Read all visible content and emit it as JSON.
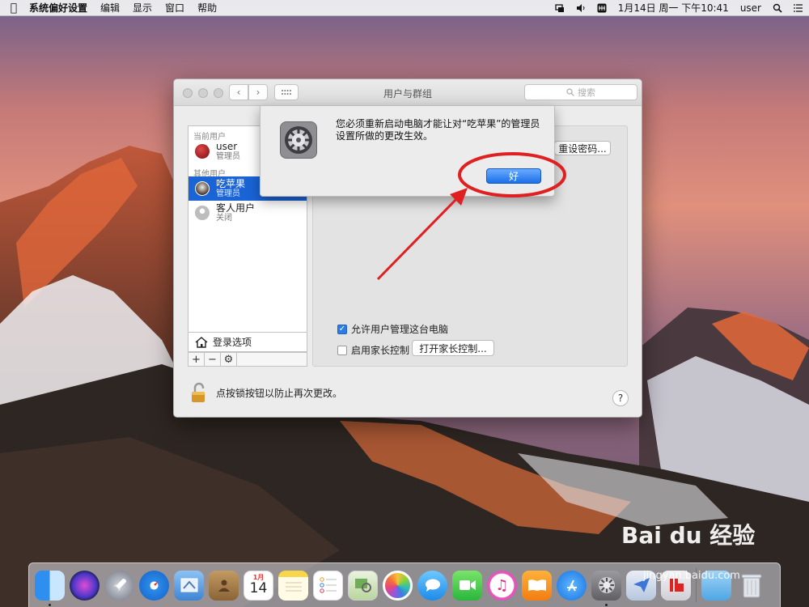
{
  "menubar": {
    "apple_icon": "apple-icon",
    "app_name": "系统偏好设置",
    "menus": [
      "编辑",
      "显示",
      "窗口",
      "帮助"
    ],
    "status": {
      "date_time": "1月14日 周一 下午10:41",
      "user": "user"
    }
  },
  "window": {
    "title": "用户与群组",
    "search_placeholder": "搜索",
    "current_users_header": "当前用户",
    "other_users_header": "其他用户",
    "users": [
      {
        "name": "user",
        "role": "管理员",
        "avatar_color": "#a0121a"
      },
      {
        "name": "吃苹果",
        "role": "管理员",
        "avatar_color": "#6b5a4a"
      },
      {
        "name": "客人用户",
        "role": "关闭",
        "avatar_color": "#c9c9c9"
      }
    ],
    "login_options": "登录选项",
    "reset_password_button": "重设密码...",
    "allow_admin_checkbox": "允许用户管理这台电脑",
    "parental_checkbox": "启用家长控制",
    "parental_button": "打开家长控制...",
    "lock_text": "点按锁按钮以防止再次更改。",
    "help": "?"
  },
  "alert": {
    "message": "您必须重新启动电脑才能让对“吃苹果”的管理员设置所做的更改生效。",
    "ok_button": "好"
  },
  "dock": {
    "calendar_month": "1月",
    "calendar_day": "14"
  },
  "watermark": {
    "text": "Bai du 经验",
    "url": "jingyan.baidu.com"
  },
  "colors": {
    "accent": "#1a64d6",
    "annotation": "#e02020"
  }
}
